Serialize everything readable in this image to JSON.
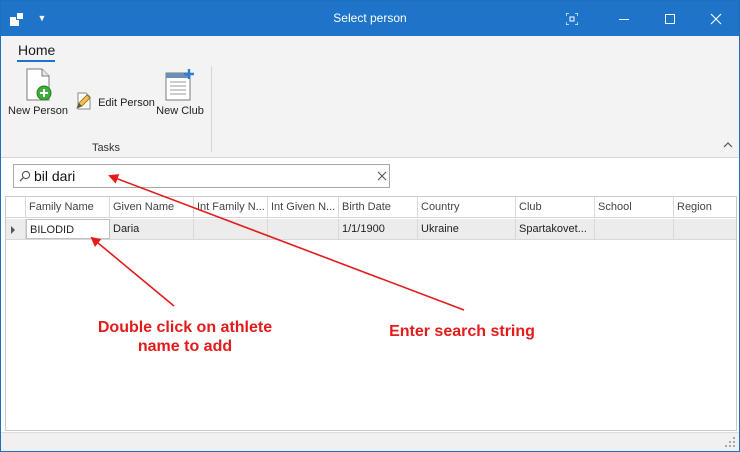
{
  "window": {
    "title": "Select person",
    "accent_color": "#1e74c8"
  },
  "titlebar_icons": {
    "app": "app-icon",
    "quick_access": "chevron-down-icon",
    "focus": "focus-mode-icon",
    "minimize": "minimize-icon",
    "maximize": "maximize-icon",
    "close": "close-icon"
  },
  "ribbon": {
    "tabs": [
      {
        "label": "Home",
        "active": true
      }
    ],
    "buttons": {
      "new_person": "New Person",
      "edit_person": "Edit Person",
      "new_club": "New Club"
    },
    "group_label": "Tasks"
  },
  "search": {
    "value": "bil dari",
    "placeholder": ""
  },
  "grid": {
    "columns": [
      "Family Name",
      "Given Name",
      "Int Family N...",
      "Int Given N...",
      "Birth Date",
      "Country",
      "Club",
      "School",
      "Region"
    ],
    "rows": [
      {
        "family_name": "BILODID",
        "given_name": "Daria",
        "int_family_name": "",
        "int_given_name": "",
        "birth_date": "1/1/1900",
        "country": "Ukraine",
        "club": "Spartakovet...",
        "school": "",
        "region": ""
      }
    ]
  },
  "annotations": {
    "left": "Double click on athlete name to add",
    "right": "Enter search string",
    "color": "#e31b1b"
  }
}
